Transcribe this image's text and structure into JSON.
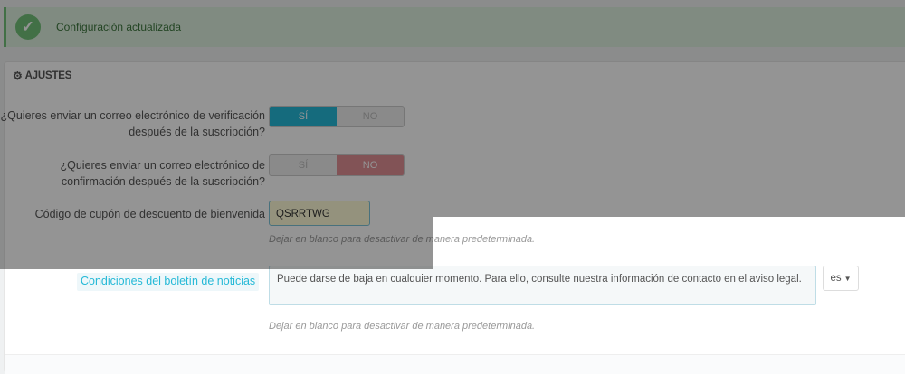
{
  "alert": {
    "message": "Configuración actualizada"
  },
  "panel": {
    "title": "AJUSTES"
  },
  "fields": {
    "verification": {
      "label": "¿Quieres enviar un correo electrónico de verificación después de la suscripción?",
      "yes": "SÍ",
      "no": "NO",
      "value": "yes"
    },
    "confirmation": {
      "label": "¿Quieres enviar un correo electrónico de confirmación después de la suscripción?",
      "yes": "SÍ",
      "no": "NO",
      "value": "no"
    },
    "coupon": {
      "label": "Código de cupón de descuento de bienvenida",
      "value": "QSRRTWG",
      "help": "Dejar en blanco para desactivar de manera predeterminada."
    },
    "conditions": {
      "label": "Condiciones del boletín de noticias",
      "value": "Puede darse de baja en cualquier momento. Para ello, consulte nuestra información de contacto en el aviso legal.",
      "language": "es",
      "help": "Dejar en blanco para desactivar de manera predeterminada."
    }
  }
}
